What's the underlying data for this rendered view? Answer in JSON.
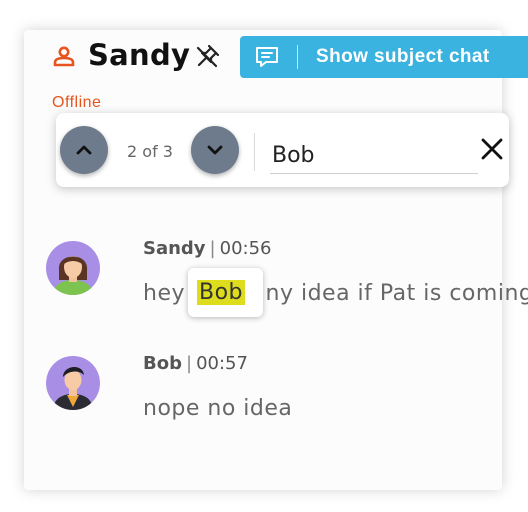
{
  "header": {
    "name": "Sandy",
    "status": "Offline",
    "subject_button_label": "Show subject chat",
    "icons": [
      "user-icon",
      "pin-off-icon",
      "chat-icon"
    ]
  },
  "search": {
    "counter": "2 of 3",
    "query": "Bob",
    "icons": [
      "chevron-up-icon",
      "chevron-down-icon",
      "close-icon"
    ]
  },
  "messages": [
    {
      "author": "Sandy",
      "time": "00:56",
      "text_before": "hey ",
      "highlight": "Bob",
      "text_after": ", any idea if Pat is coming"
    },
    {
      "author": "Bob",
      "time": "00:57",
      "text": "nope no idea"
    }
  ],
  "colors": {
    "accent": "#3bb3e0",
    "status_offline": "#e8541e",
    "nav_button": "#6e7b8c",
    "highlight": "#dddd1e"
  }
}
